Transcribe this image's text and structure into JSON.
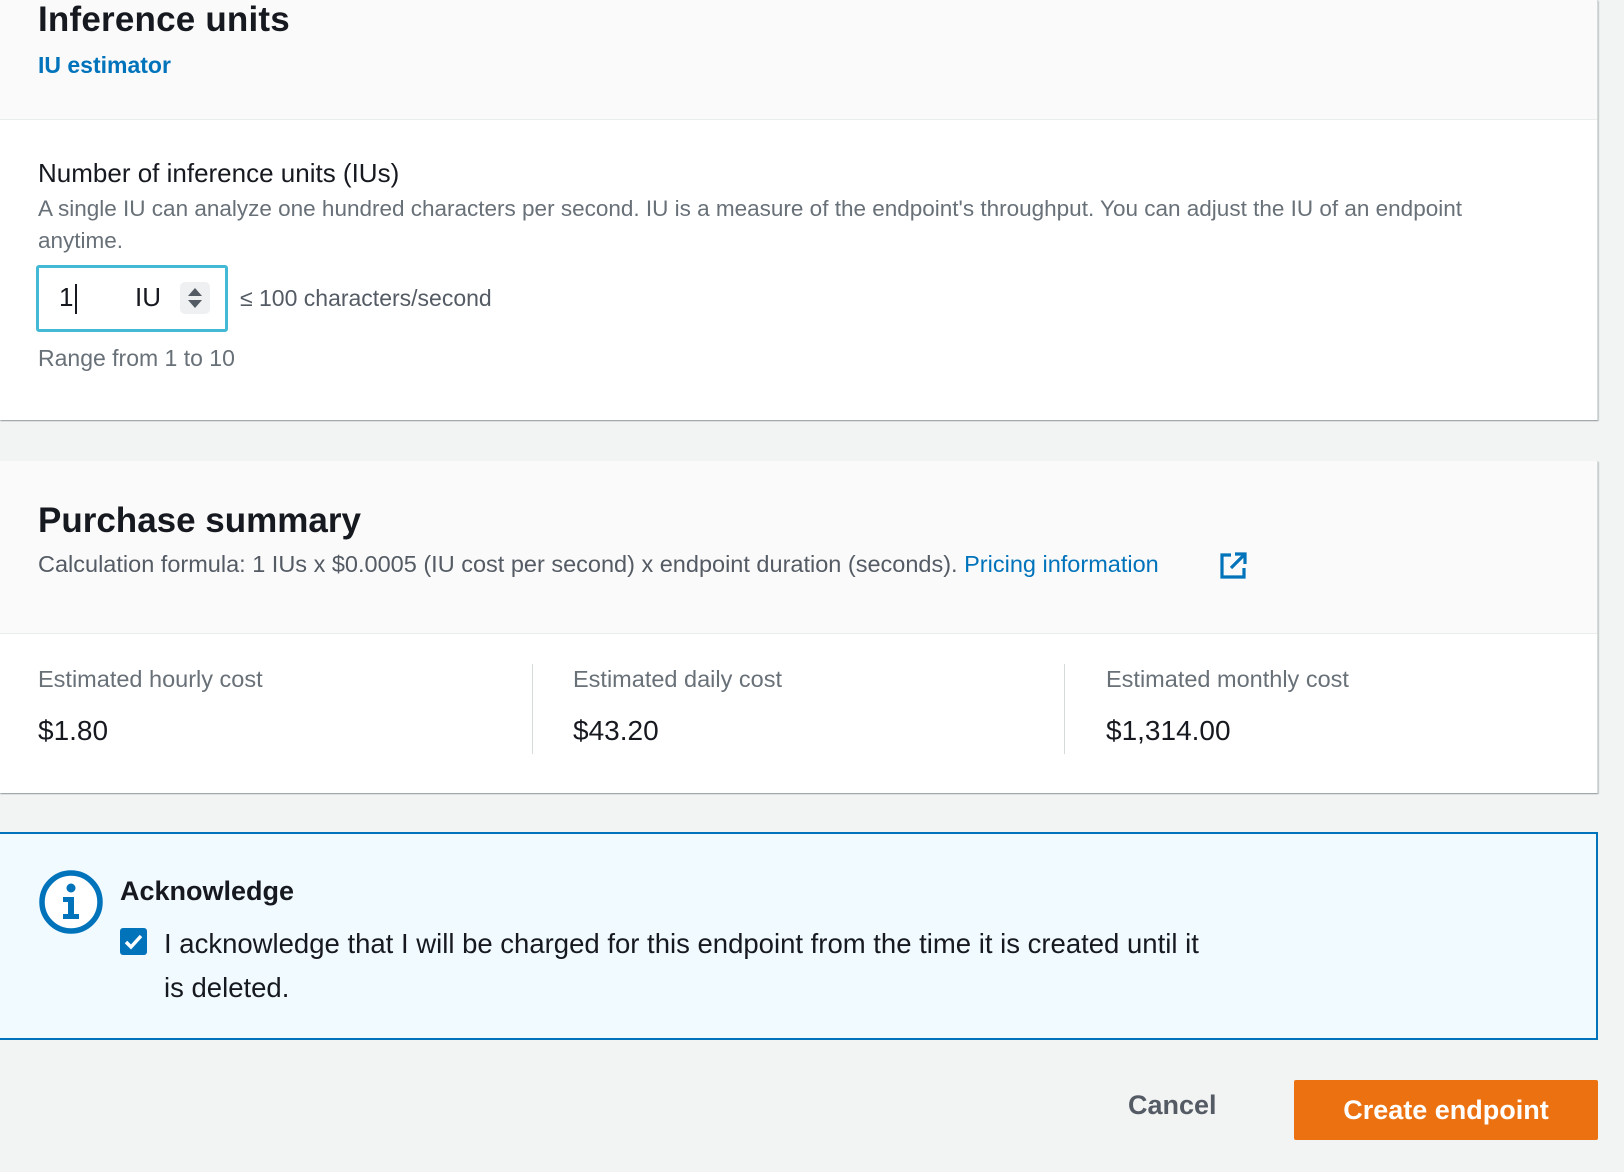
{
  "inference_units": {
    "title": "Inference units",
    "estimator_link": "IU estimator",
    "field_label": "Number of inference units (IUs)",
    "field_description": "A single IU can analyze one hundred characters per second. IU is a measure of the endpoint's throughput. You can adjust the IU of an endpoint anytime.",
    "input_value": "1",
    "input_unit": "IU",
    "throughput_hint": "≤ 100 characters/second",
    "range_hint": "Range from 1 to 10"
  },
  "purchase_summary": {
    "title": "Purchase summary",
    "formula": "Calculation formula: 1 IUs x $0.0005 (IU cost per second) x endpoint duration (seconds).",
    "pricing_link": "Pricing information",
    "costs": [
      {
        "label": "Estimated hourly cost",
        "amount": "$1.80"
      },
      {
        "label": "Estimated daily cost",
        "amount": "$43.20"
      },
      {
        "label": "Estimated monthly cost",
        "amount": "$1,314.00"
      }
    ]
  },
  "acknowledge": {
    "title": "Acknowledge",
    "checkbox_checked": true,
    "checkbox_label": "I acknowledge that I will be charged for this endpoint from the time it is created until it is deleted."
  },
  "actions": {
    "cancel": "Cancel",
    "create": "Create endpoint"
  },
  "icons": {
    "info": "info-icon",
    "external_link": "external-link-icon",
    "spinner": "stepper-arrows-icon",
    "check": "checkmark-icon"
  },
  "colors": {
    "accent": "#0073bb",
    "primary_button": "#ec7211",
    "focus_ring": "#44b9d6",
    "alert_background": "#f1faff"
  }
}
